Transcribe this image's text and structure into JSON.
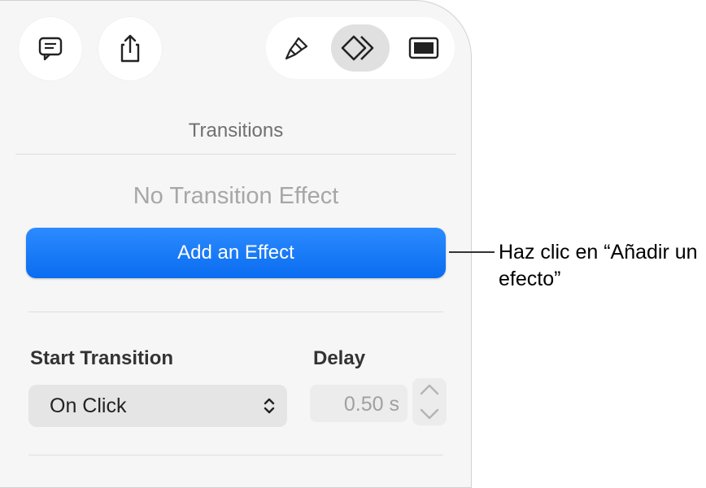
{
  "toolbar": {
    "comment_icon": "comment-icon",
    "share_icon": "share-icon",
    "format_icon": "paintbrush-icon",
    "animate_icon": "animate-diamonds-icon",
    "document_icon": "document-icon"
  },
  "inspector": {
    "section_title": "Transitions",
    "empty_state": "No Transition Effect",
    "add_button": "Add an Effect",
    "start_label": "Start Transition",
    "start_value": "On Click",
    "delay_label": "Delay",
    "delay_value": "0.50 s"
  },
  "callout": {
    "text": "Haz clic en “Añadir un efecto”"
  },
  "colors": {
    "accent": "#0A6CF0",
    "panel_bg": "#F6F6F6"
  }
}
